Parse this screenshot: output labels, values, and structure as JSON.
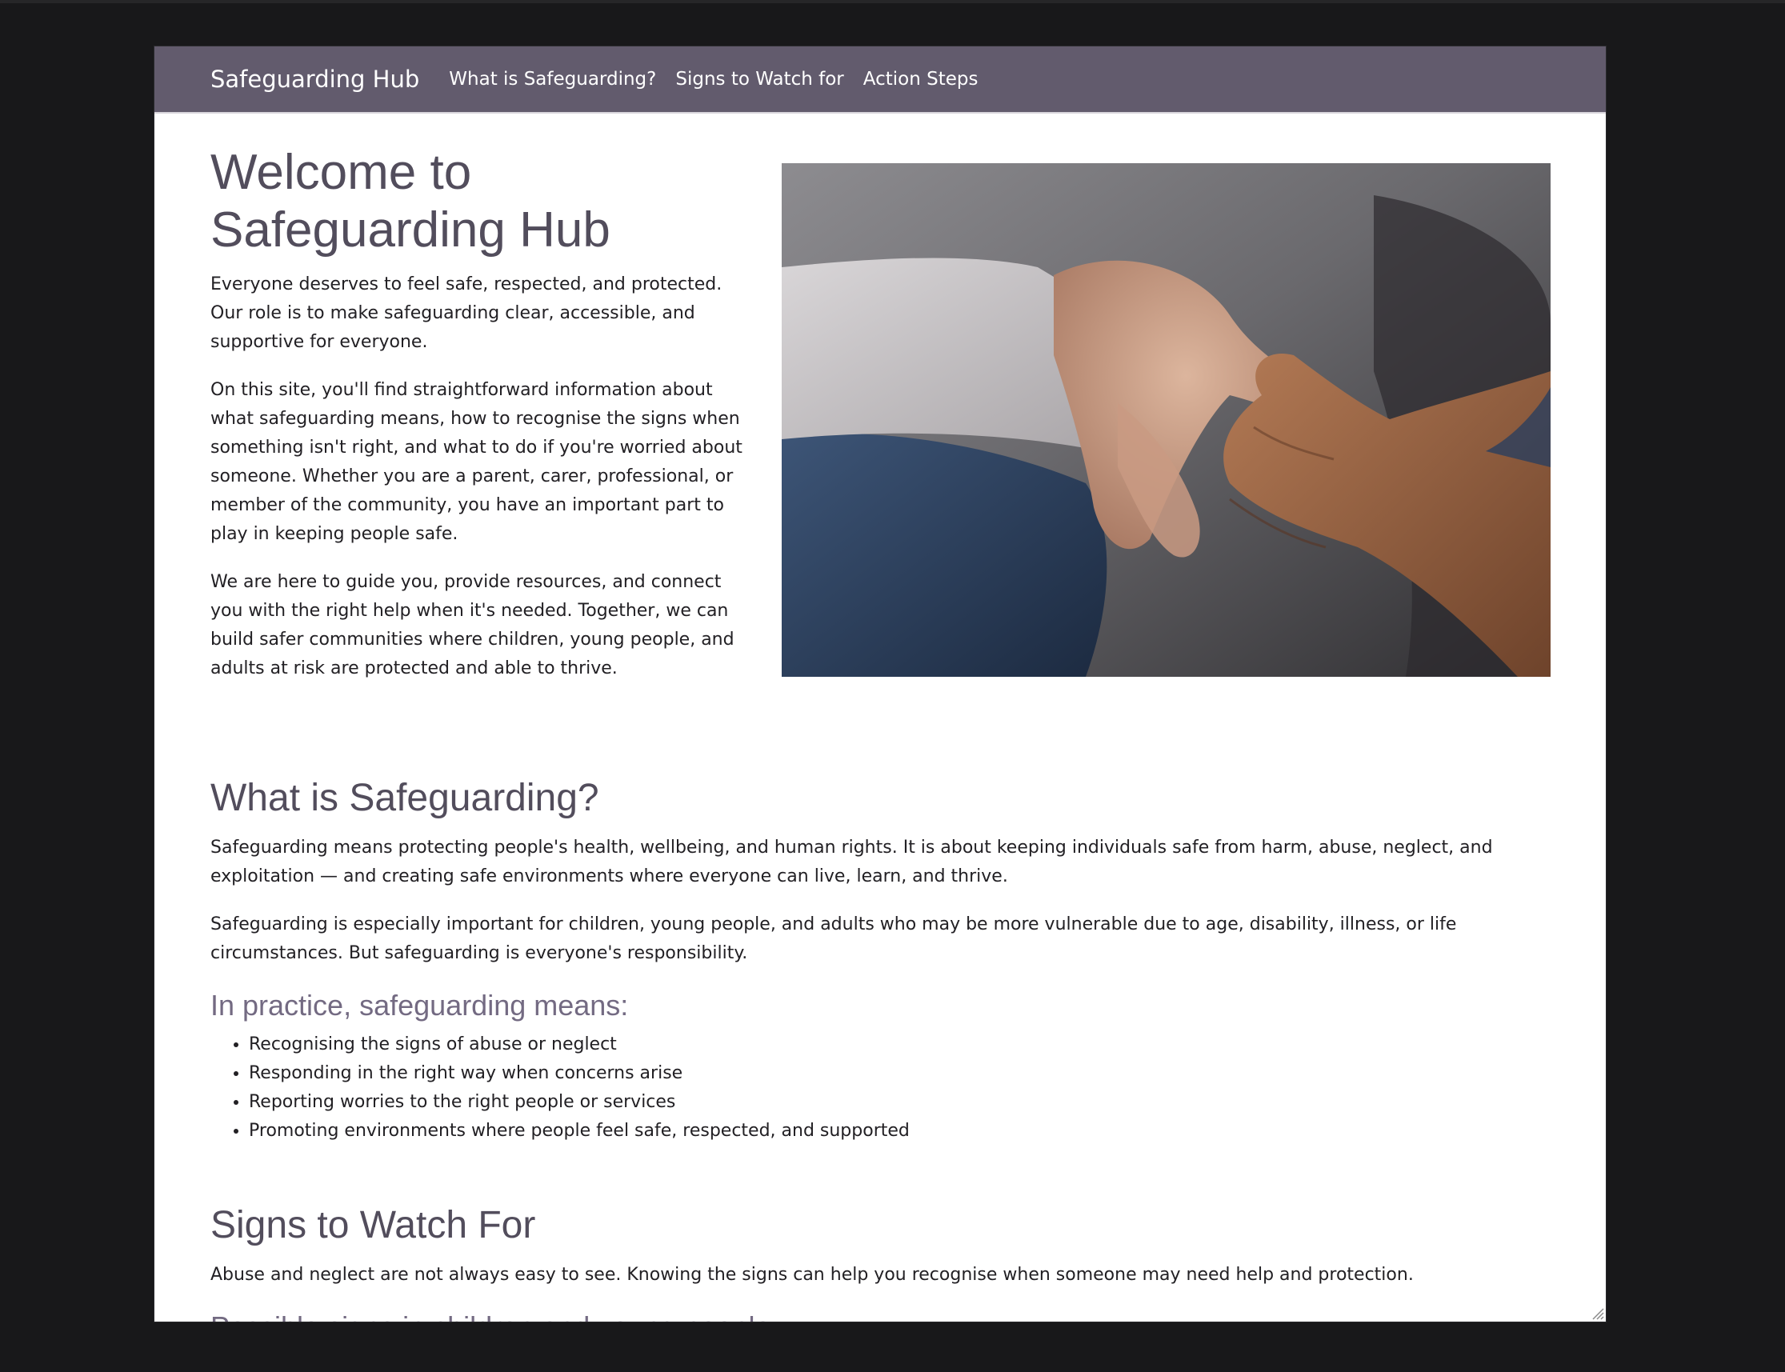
{
  "navbar": {
    "brand": "Safeguarding Hub",
    "links": [
      "What is Safeguarding?",
      "Signs to Watch for",
      "Action Steps"
    ]
  },
  "hero": {
    "title_line1": "Welcome to",
    "title_line2": "Safeguarding Hub",
    "paragraphs": [
      "Everyone deserves to feel safe, respected, and protected. Our role is to make safeguarding clear, accessible, and supportive for everyone.",
      "On this site, you'll find straightforward information about what safeguarding means, how to recognise the signs when something isn't right, and what to do if you're worried about someone. Whether you are a parent, carer, professional, or member of the community, you have an important part to play in keeping people safe.",
      "We are here to guide you, provide resources, and connect you with the right help when it's needed. Together, we can build safer communities where children, young people, and adults at risk are protected and able to thrive."
    ]
  },
  "what_is": {
    "title": "What is Safeguarding?",
    "paragraphs": [
      "Safeguarding means protecting people's health, wellbeing, and human rights. It is about keeping individuals safe from harm, abuse, neglect, and exploitation — and creating safe environments where everyone can live, learn, and thrive.",
      "Safeguarding is especially important for children, young people, and adults who may be more vulnerable due to age, disability, illness, or life circumstances. But safeguarding is everyone's responsibility."
    ],
    "practice_title": "In practice, safeguarding means:",
    "practice_items": [
      "Recognising the signs of abuse or neglect",
      "Responding in the right way when concerns arise",
      "Reporting worries to the right people or services",
      "Promoting environments where people feel safe, respected, and supported"
    ]
  },
  "signs": {
    "title": "Signs to Watch For",
    "intro": "Abuse and neglect are not always easy to see. Knowing the signs can help you recognise when someone may need help and protection.",
    "children_title": "Possible signs in children and young people:"
  },
  "colors": {
    "navbar": "#625b6d",
    "heading": "#524d5c",
    "subheading": "#736a82",
    "page_background": "#18181a"
  }
}
